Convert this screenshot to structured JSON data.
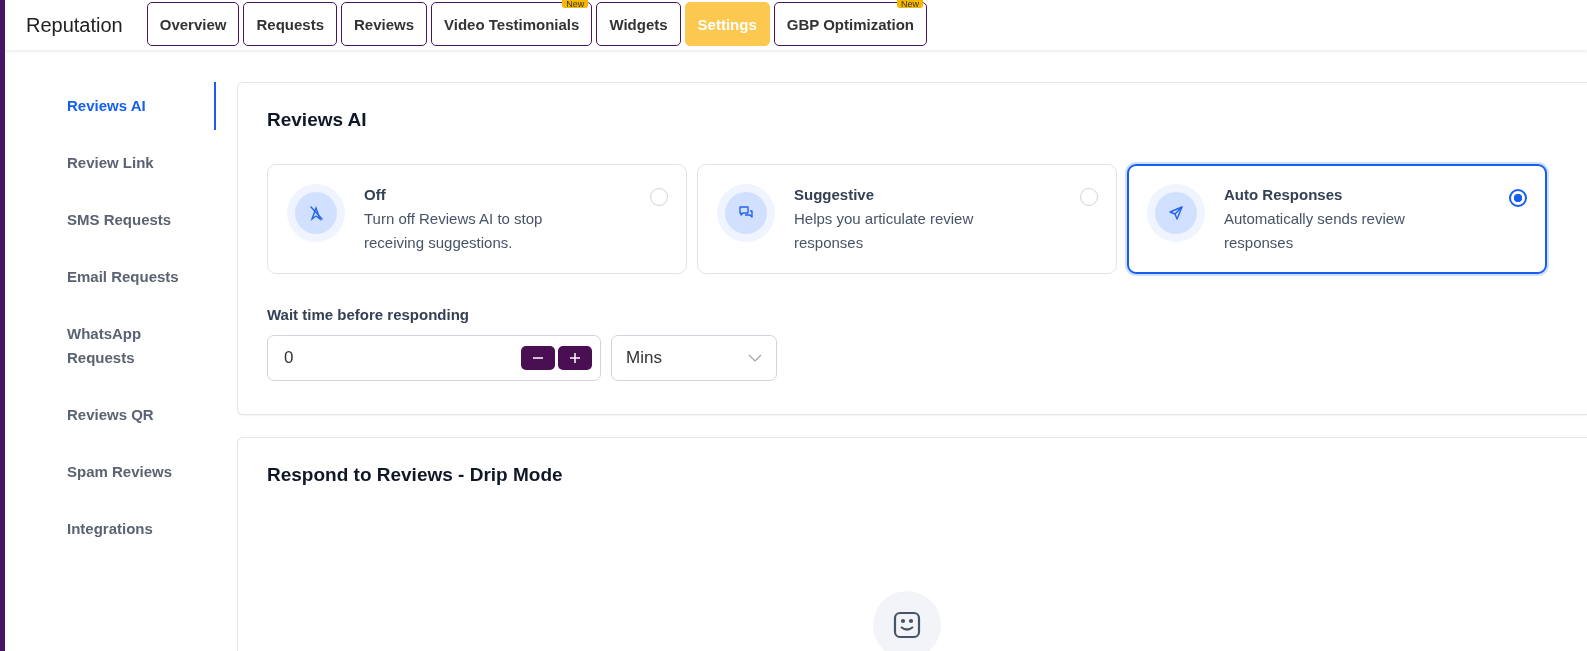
{
  "app_title": "Reputation",
  "tabs": [
    {
      "label": "Overview",
      "selected": false
    },
    {
      "label": "Requests",
      "selected": false
    },
    {
      "label": "Reviews",
      "selected": false
    },
    {
      "label": "Video Testimonials",
      "selected": false,
      "badge": "New"
    },
    {
      "label": "Widgets",
      "selected": false
    },
    {
      "label": "Settings",
      "selected": true
    },
    {
      "label": "GBP Optimization",
      "selected": false,
      "badge": "New"
    }
  ],
  "sidebar": {
    "items": [
      {
        "label": "Reviews AI",
        "selected": true
      },
      {
        "label": "Review Link",
        "selected": false
      },
      {
        "label": "SMS Requests",
        "selected": false
      },
      {
        "label": "Email Requests",
        "selected": false
      },
      {
        "label": "WhatsApp Requests",
        "selected": false
      },
      {
        "label": "Reviews QR",
        "selected": false
      },
      {
        "label": "Spam Reviews",
        "selected": false
      },
      {
        "label": "Integrations",
        "selected": false
      }
    ]
  },
  "reviews_ai": {
    "title": "Reviews AI",
    "options": [
      {
        "kind": "off",
        "title": "Off",
        "description": "Turn off Reviews AI to stop receiving suggestions.",
        "selected": false
      },
      {
        "kind": "suggestive",
        "title": "Suggestive",
        "description": "Helps you articulate review responses",
        "selected": false
      },
      {
        "kind": "auto",
        "title": "Auto Responses",
        "description": "Automatically sends review responses",
        "selected": true
      }
    ],
    "wait_label": "Wait time before responding",
    "wait_value": "0",
    "unit": "Mins"
  },
  "drip": {
    "title": "Respond to Reviews - Drip Mode"
  }
}
